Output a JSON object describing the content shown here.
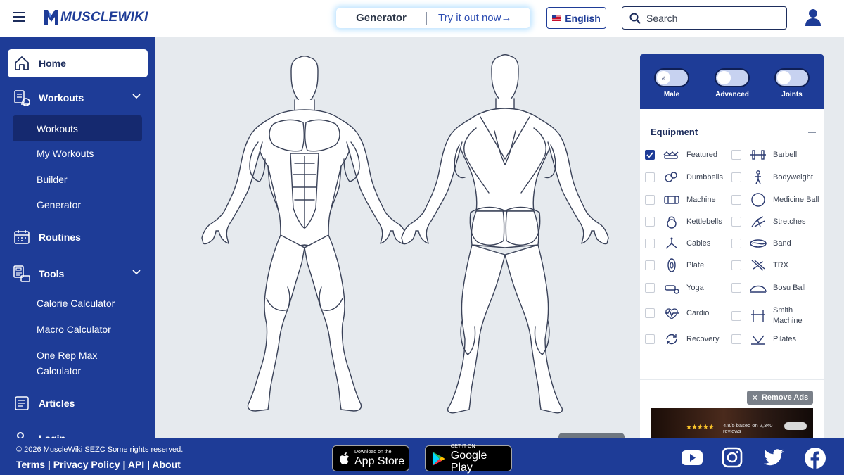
{
  "header": {
    "logo_text": "MUSCLEWIKI",
    "generator_title": "Generator",
    "generator_link": "Try it out now→",
    "language_label": "English",
    "search_placeholder": "Search"
  },
  "sidebar": {
    "home": "Home",
    "workouts": "Workouts",
    "workouts_sub": [
      "Workouts",
      "My Workouts",
      "Builder",
      "Generator"
    ],
    "routines": "Routines",
    "tools": "Tools",
    "tools_sub": [
      "Calorie Calculator",
      "Macro Calculator",
      "One Rep Max",
      "Calculator"
    ],
    "articles": "Articles",
    "login": "Login"
  },
  "toggles": [
    {
      "label": "Male",
      "symbol": "♂",
      "on": false
    },
    {
      "label": "Advanced",
      "on": false
    },
    {
      "label": "Joints",
      "on": false
    }
  ],
  "equipment": {
    "title": "Equipment",
    "items": [
      {
        "label": "Featured",
        "checked": true,
        "icon": "featured-icon"
      },
      {
        "label": "Barbell",
        "checked": false,
        "icon": "barbell-icon"
      },
      {
        "label": "Dumbbells",
        "checked": false,
        "icon": "dumbbells-icon"
      },
      {
        "label": "Bodyweight",
        "checked": false,
        "icon": "bodyweight-icon"
      },
      {
        "label": "Machine",
        "checked": false,
        "icon": "machine-icon"
      },
      {
        "label": "Medicine Ball",
        "checked": false,
        "icon": "medicine-ball-icon"
      },
      {
        "label": "Kettlebells",
        "checked": false,
        "icon": "kettlebell-icon"
      },
      {
        "label": "Stretches",
        "checked": false,
        "icon": "stretches-icon"
      },
      {
        "label": "Cables",
        "checked": false,
        "icon": "cables-icon"
      },
      {
        "label": "Band",
        "checked": false,
        "icon": "band-icon"
      },
      {
        "label": "Plate",
        "checked": false,
        "icon": "plate-icon"
      },
      {
        "label": "TRX",
        "checked": false,
        "icon": "trx-icon"
      },
      {
        "label": "Yoga",
        "checked": false,
        "icon": "yoga-icon"
      },
      {
        "label": "Bosu Ball",
        "checked": false,
        "icon": "bosu-ball-icon"
      },
      {
        "label": "Cardio",
        "checked": false,
        "icon": "cardio-icon"
      },
      {
        "label": "Smith Machine",
        "checked": false,
        "icon": "smith-machine-icon"
      },
      {
        "label": "Recovery",
        "checked": false,
        "icon": "recovery-icon"
      },
      {
        "label": "Pilates",
        "checked": false,
        "icon": "pilates-icon"
      }
    ]
  },
  "ad": {
    "remove_label": "Remove Ads",
    "rating_text": "4.8/5 based on 2,340 reviews"
  },
  "footer": {
    "copyright": "© 2026 MuscleWiki SEZC Some rights reserved.",
    "links": [
      "Terms",
      "Privacy Policy",
      "API",
      "About"
    ],
    "app_store_small": "Download on the",
    "app_store_big": "App Store",
    "google_play_small": "GET IT ON",
    "google_play_big": "Google Play"
  },
  "colors": {
    "brand_blue": "#1e3c97",
    "dark_navy": "#15296f",
    "canvas_bg": "#e6eaee",
    "figure_stroke": "#3a4258"
  }
}
